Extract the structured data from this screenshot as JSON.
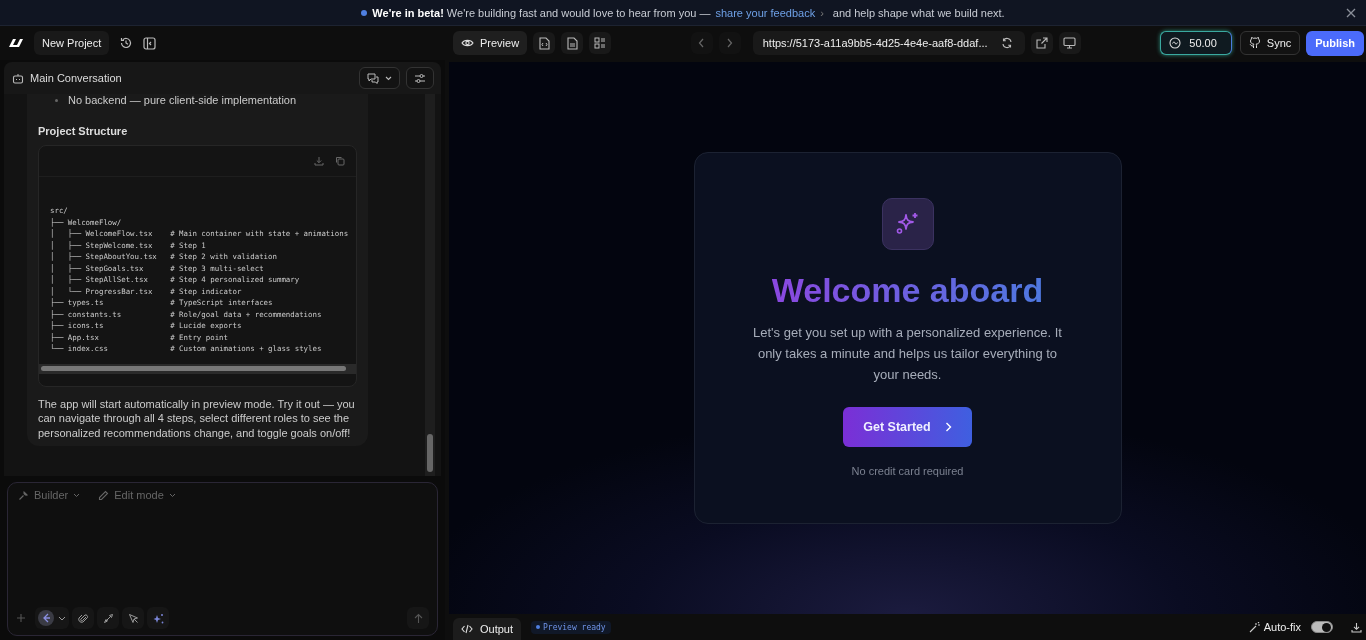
{
  "banner": {
    "bold": "We're in beta!",
    "text": "We're building fast and would love to hear from you —",
    "link": "share your feedback",
    "chevron": "›",
    "after": "and help shape what we build next."
  },
  "topbar": {
    "project": "New Project",
    "preview_tab": {
      "label": "Preview",
      "selected": true
    },
    "url": "https://5173-a11a9bb5-4d25-4e4e-aaf8-ddaf...",
    "credits": "50.00",
    "sync": "Sync",
    "publish": "Publish"
  },
  "conversation": {
    "title": "Main Conversation",
    "bullet": "No backend — pure client-side implementation",
    "heading": "Project Structure",
    "code": [
      "src/",
      "├── WelcomeFlow/",
      "│   ├── WelcomeFlow.tsx    # Main container with state + animations",
      "│   ├── StepWelcome.tsx    # Step 1",
      "│   ├── StepAboutYou.tsx   # Step 2 with validation",
      "│   ├── StepGoals.tsx      # Step 3 multi-select",
      "│   ├── StepAllSet.tsx     # Step 4 personalized summary",
      "│   └── ProgressBar.tsx    # Step indicator",
      "├── types.ts               # TypeScript interfaces",
      "├── constants.ts           # Role/goal data + recommendations",
      "├── icons.ts               # Lucide exports",
      "├── App.tsx                # Entry point",
      "└── index.css              # Custom animations + glass styles"
    ],
    "paragraph": "The app will start automatically in preview mode. Try it out — you can navigate through all 4 steps, select different roles to see the personalized recommendations change, and toggle goals on/off!"
  },
  "composer": {
    "mode": "Builder",
    "edit_mode": "Edit mode"
  },
  "preview": {
    "title": "Welcome aboard",
    "subtitle": "Let's get you set up with a personalized experience. It only takes a minute and helps us tailor everything to your needs.",
    "button": "Get Started",
    "note": "No credit card required"
  },
  "bottom_bar": {
    "output_tab": {
      "label": "Output",
      "selected": true
    },
    "status": "Preview ready",
    "autofix": {
      "label": "Auto-fix",
      "on": true
    }
  }
}
